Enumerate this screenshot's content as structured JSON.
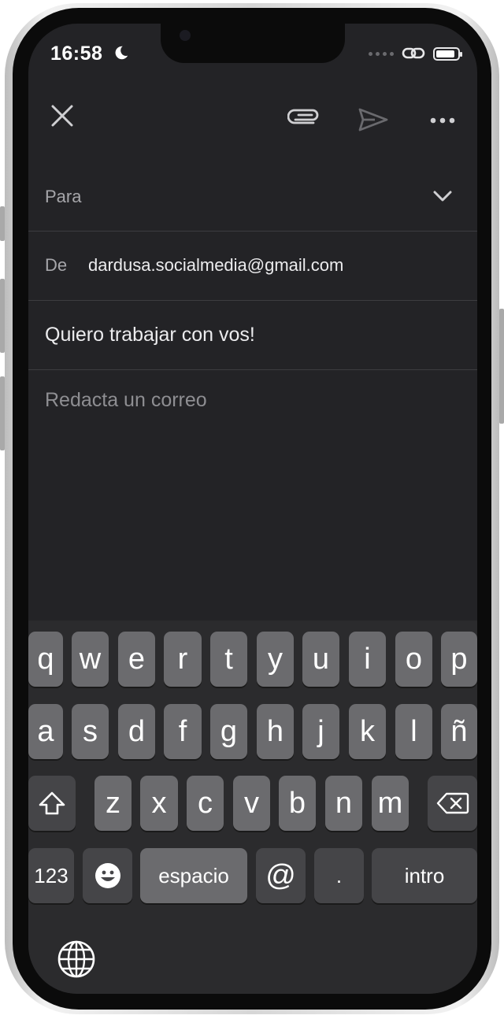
{
  "status_bar": {
    "time": "16:58"
  },
  "compose": {
    "to_label": "Para",
    "from_label": "De",
    "from_value": "dardusa.socialmedia@gmail.com",
    "subject": "Quiero trabajar con vos!",
    "body_placeholder": "Redacta un correo"
  },
  "keyboard": {
    "row1": [
      "q",
      "w",
      "e",
      "r",
      "t",
      "y",
      "u",
      "i",
      "o",
      "p"
    ],
    "row2": [
      "a",
      "s",
      "d",
      "f",
      "g",
      "h",
      "j",
      "k",
      "l",
      "ñ"
    ],
    "row3": [
      "z",
      "x",
      "c",
      "v",
      "b",
      "n",
      "m"
    ],
    "numbers_label": "123",
    "space_label": "espacio",
    "at_label": "@",
    "dot_label": ".",
    "return_label": "intro"
  },
  "icons": {
    "close": "close-icon",
    "attach": "paperclip-icon",
    "send": "send-icon",
    "more": "more-icon",
    "expand": "chevron-down-icon",
    "shift": "shift-icon",
    "delete": "backspace-icon",
    "emoji": "emoji-icon",
    "globe": "globe-icon",
    "moon": "moon-icon",
    "link": "link-icon",
    "battery": "battery-icon"
  }
}
